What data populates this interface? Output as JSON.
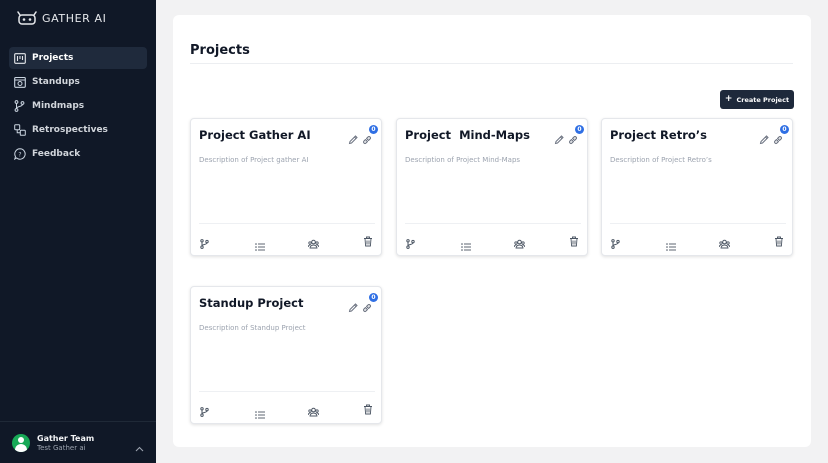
{
  "app": {
    "name": "GATHER AI"
  },
  "sidebar": {
    "items": [
      {
        "label": "Projects",
        "icon": "projects-icon",
        "active": true
      },
      {
        "label": "Standups",
        "icon": "standups-icon",
        "active": false
      },
      {
        "label": "Mindmaps",
        "icon": "mindmaps-icon",
        "active": false
      },
      {
        "label": "Retrospectives",
        "icon": "retrospectives-icon",
        "active": false
      },
      {
        "label": "Feedback",
        "icon": "feedback-icon",
        "active": false
      }
    ]
  },
  "user": {
    "name": "Gather Team",
    "subtitle": "Test Gather ai",
    "toggle_icon": "chevron-up-icon"
  },
  "main": {
    "title": "Projects",
    "create_button": {
      "label": "Create Project",
      "icon": "plus-icon"
    }
  },
  "projects": [
    {
      "title": "Project Gather AI",
      "description": "Description of Project gather AI",
      "badge": "0"
    },
    {
      "title": "Project  Mind-Maps",
      "description": "Description of Project Mind-Maps",
      "badge": "0"
    },
    {
      "title": "Project Retro’s",
      "description": "Description of Project Retro’s",
      "badge": "0"
    },
    {
      "title": "Standup Project",
      "description": "Description of Standup Project",
      "badge": "0"
    }
  ],
  "card_actions": [
    "mindmap-icon",
    "list-icon",
    "team-icon",
    "trash-icon"
  ],
  "colors": {
    "sidebar_bg": "#101827",
    "accent": "#2f6fe4",
    "button_bg": "#1e293b",
    "avatar": "#18a957"
  }
}
